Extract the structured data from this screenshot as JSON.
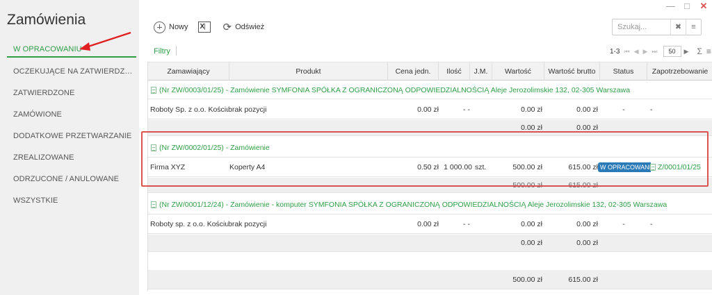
{
  "app": {
    "title": "Zamówienia"
  },
  "window": {
    "minimize": "—",
    "maximize": "□",
    "close": "✕"
  },
  "sidebar": {
    "items": [
      {
        "label": "W OPRACOWANIU",
        "active": true
      },
      {
        "label": "OCZEKUJĄCE NA ZATWIERDZEN..."
      },
      {
        "label": "ZATWIERDZONE"
      },
      {
        "label": "ZAMÓWIONE"
      },
      {
        "label": "DODATKOWE PRZETWARZANIE"
      },
      {
        "label": "ZREALIZOWANE"
      },
      {
        "label": "ODRZUCONE / ANULOWANE"
      },
      {
        "label": "WSZYSTKIE"
      }
    ]
  },
  "toolbar": {
    "new_label": "Nowy",
    "refresh_label": "Odśwież",
    "excel_label": "X",
    "search_placeholder": "Szukaj...",
    "clear_icon": "✖",
    "menu_icon": "≡",
    "filters_label": "Filtry"
  },
  "pager": {
    "range": "1-3",
    "first": "⏮",
    "prev": "◀",
    "next": "▶",
    "last": "⏭",
    "page_size": "50",
    "sigma": "Σ",
    "menu": "≡"
  },
  "table": {
    "columns": [
      "Zamawiający",
      "Produkt",
      "Cena jedn.",
      "Ilość",
      "J.M.",
      "Wartość",
      "Wartość brutto",
      "Status",
      "Zapotrzebowanie"
    ],
    "groups": [
      {
        "title": "(Nr ZW/0003/01/25) - Zamówienie SYMFONIA SPÓŁKA Z OGRANICZONĄ ODPOWIEDZIALNOŚCIĄ Aleje Jerozolimskie 132, 02-305 Warszawa",
        "row": {
          "ordering": "Roboty Sp. z o.o. Kościuszk",
          "product": "brak pozycji",
          "price": "0.00 zł",
          "qty": "- -",
          "unit": "",
          "value": "0.00 zł",
          "gross": "0.00 zł",
          "status": "-",
          "demand": "-"
        },
        "subtotal": {
          "value": "0.00 zł",
          "gross": "0.00 zł"
        }
      },
      {
        "title": "(Nr ZW/0002/01/25) - Zamówienie",
        "row": {
          "ordering": "Firma XYZ",
          "product": "Koperty A4",
          "price": "0.50 zł",
          "qty": "1 000.00",
          "unit": "szt.",
          "value": "500.00 zł",
          "gross": "615.00 zł",
          "status": "W OPRACOWANIU",
          "demand": "Z/0001/01/25"
        },
        "subtotal": {
          "value": "500.00 zł",
          "gross": "615.00 zł"
        }
      },
      {
        "title": "(Nr ZW/0001/12/24) - Zamówienie - komputer SYMFONIA SPÓŁKA Z OGRANICZONĄ ODPOWIEDZIALNOŚCIĄ Aleje Jerozolimskie 132, 02-305 Warszawa",
        "row": {
          "ordering": "Roboty sp. z o.o. Kościuszk",
          "product": "brak pozycji",
          "price": "0.00 zł",
          "qty": "- -",
          "unit": "",
          "value": "0.00 zł",
          "gross": "0.00 zł",
          "status": "-",
          "demand": "-"
        },
        "subtotal": {
          "value": "0.00 zł",
          "gross": "0.00 zł"
        }
      }
    ],
    "total": {
      "value": "500.00 zł",
      "gross": "615.00 zł"
    }
  }
}
